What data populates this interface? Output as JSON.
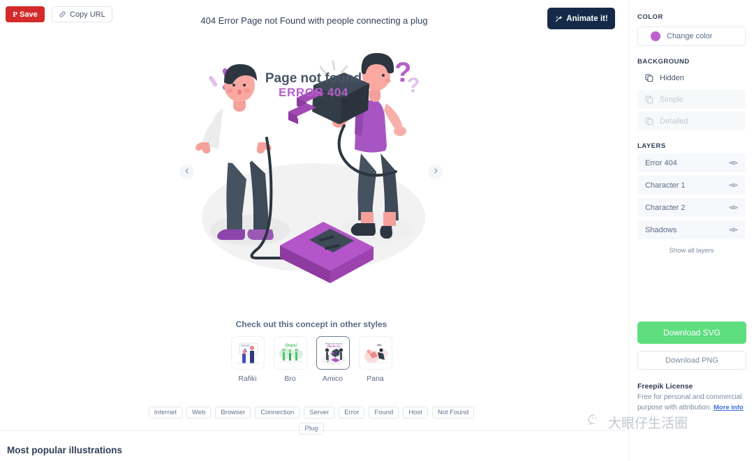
{
  "topbar": {
    "save_label": "Save",
    "save_icon": "pinterest-icon",
    "copy_url_label": "Copy URL",
    "copy_url_icon": "link-icon",
    "animate_label": "Animate it!",
    "animate_icon": "magic-wand-icon",
    "animate_bg": "#142a48",
    "save_bg": "#d32b2b"
  },
  "document": {
    "title": "404 Error Page not Found with people connecting a plug"
  },
  "viewer": {
    "prev_icon": "chevron-left-icon",
    "next_icon": "chevron-right-icon",
    "illustration": {
      "headline": "Page not found",
      "subhead": "ERROR 404",
      "headline_color": "#4a5568",
      "subhead_color": "#b45fc7",
      "accent_color": "#a349b5"
    }
  },
  "styles": {
    "title": "Check out this concept in other styles",
    "items": [
      {
        "label": "Rafiki",
        "selected": false
      },
      {
        "label": "Bro",
        "selected": false
      },
      {
        "label": "Amico",
        "selected": true
      },
      {
        "label": "Pana",
        "selected": false
      }
    ]
  },
  "tags": [
    "Internet",
    "Web",
    "Browser",
    "Connection",
    "Server",
    "Error",
    "Found",
    "Host",
    "Not Found",
    "Plug"
  ],
  "bottom": {
    "popular_title": "Most popular illustrations"
  },
  "sidebar": {
    "color": {
      "section_title": "COLOR",
      "change_label": "Change color",
      "swatch": "#bf5fd0"
    },
    "background": {
      "section_title": "BACKGROUND",
      "options": [
        {
          "label": "Hidden",
          "disabled": false
        },
        {
          "label": "Simple",
          "disabled": true
        },
        {
          "label": "Detailed",
          "disabled": true
        }
      ]
    },
    "layers": {
      "section_title": "LAYERS",
      "items": [
        {
          "label": "Error 404"
        },
        {
          "label": "Character 1"
        },
        {
          "label": "Character 2"
        },
        {
          "label": "Shadows"
        }
      ],
      "show_all_label": "Show all layers"
    },
    "download": {
      "svg_label": "Download SVG",
      "svg_color": "#5ede7f",
      "png_label": "Download PNG"
    },
    "license": {
      "title": "Freepik License",
      "text": "Free for personal and commercial purpose with attribution. ",
      "more_info": "More info"
    }
  },
  "watermark": {
    "text": "大眼仔生活圈",
    "icon": "wechat-icon"
  }
}
